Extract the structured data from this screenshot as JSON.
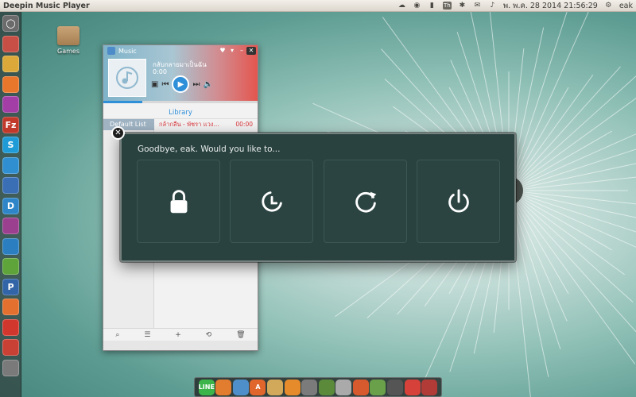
{
  "top_panel": {
    "app_title": "Deepin Music Player",
    "datetime": "พ. พ.ค. 28 2014 21:56:29",
    "username": "eak",
    "keyboard_layout": "Th"
  },
  "desktop": {
    "icons": [
      {
        "label": "Games"
      }
    ]
  },
  "launcher": {
    "items": [
      {
        "name": "launcher-dash",
        "glyph": "◯",
        "color": "#6b6b6b"
      },
      {
        "name": "launcher-files",
        "glyph": "",
        "color": "#c84f45"
      },
      {
        "name": "launcher-chrome",
        "glyph": "",
        "color": "#dba93a"
      },
      {
        "name": "launcher-firefox",
        "glyph": "",
        "color": "#e8762b"
      },
      {
        "name": "launcher-app-purple",
        "glyph": "",
        "color": "#a23ea6"
      },
      {
        "name": "launcher-filezilla",
        "glyph": "Fz",
        "color": "#c0392b"
      },
      {
        "name": "launcher-skype",
        "glyph": "S",
        "color": "#1f9bd7"
      },
      {
        "name": "launcher-telegram",
        "glyph": "",
        "color": "#2f8fd0"
      },
      {
        "name": "launcher-app-blue",
        "glyph": "",
        "color": "#3a6fb6"
      },
      {
        "name": "launcher-deepin",
        "glyph": "D",
        "color": "#2e86c9"
      },
      {
        "name": "launcher-headphones",
        "glyph": "",
        "color": "#9b3f8f"
      },
      {
        "name": "launcher-music",
        "glyph": "",
        "color": "#2b7fc0"
      },
      {
        "name": "launcher-app-green",
        "glyph": "",
        "color": "#5ea43a"
      },
      {
        "name": "launcher-app-p",
        "glyph": "P",
        "color": "#3264a8"
      },
      {
        "name": "launcher-app-orange",
        "glyph": "",
        "color": "#e3702f"
      },
      {
        "name": "launcher-app-red",
        "glyph": "",
        "color": "#d2372d"
      },
      {
        "name": "launcher-app-pdf",
        "glyph": "",
        "color": "#c94035"
      },
      {
        "name": "launcher-trash",
        "glyph": "",
        "color": "#7a7a7a"
      }
    ]
  },
  "music_player": {
    "app_name": "Music",
    "song_title": "กลับกลายมาเป็นฉัน",
    "song_time": "0:00",
    "library_label": "Library",
    "default_list_label": "Default List",
    "track_name": "กล้ากลืน - พัชรา แวง...",
    "track_duration": "00:00",
    "progress_fraction": 0.25
  },
  "logout_dialog": {
    "message": "Goodbye, eak. Would you like to...",
    "buttons": [
      {
        "name": "lock-button",
        "icon": "lock-icon"
      },
      {
        "name": "suspend-button",
        "icon": "suspend-icon"
      },
      {
        "name": "restart-button",
        "icon": "restart-icon"
      },
      {
        "name": "shutdown-button",
        "icon": "power-icon"
      }
    ]
  },
  "dock": {
    "items": [
      {
        "name": "dock-line",
        "glyph": "LINE",
        "color": "#3bb54a"
      },
      {
        "name": "dock-app-1",
        "glyph": "",
        "color": "#e27c2f"
      },
      {
        "name": "dock-app-2",
        "glyph": "",
        "color": "#4f8fc9"
      },
      {
        "name": "dock-app-3",
        "glyph": "A",
        "color": "#e0662b"
      },
      {
        "name": "dock-app-4",
        "glyph": "",
        "color": "#d2a85b"
      },
      {
        "name": "dock-app-5",
        "glyph": "",
        "color": "#e58b2c"
      },
      {
        "name": "dock-app-6",
        "glyph": "",
        "color": "#7b7b7b"
      },
      {
        "name": "dock-app-7",
        "glyph": "",
        "color": "#5a8a3a"
      },
      {
        "name": "dock-app-8",
        "glyph": "",
        "color": "#aaaaaa"
      },
      {
        "name": "dock-app-9",
        "glyph": "",
        "color": "#d75a2e"
      },
      {
        "name": "dock-app-10",
        "glyph": "",
        "color": "#6aa04a"
      },
      {
        "name": "dock-app-11",
        "glyph": "",
        "color": "#555555"
      },
      {
        "name": "dock-app-12",
        "glyph": "",
        "color": "#d6413a"
      },
      {
        "name": "dock-app-13",
        "glyph": "",
        "color": "#b03b37"
      }
    ]
  }
}
